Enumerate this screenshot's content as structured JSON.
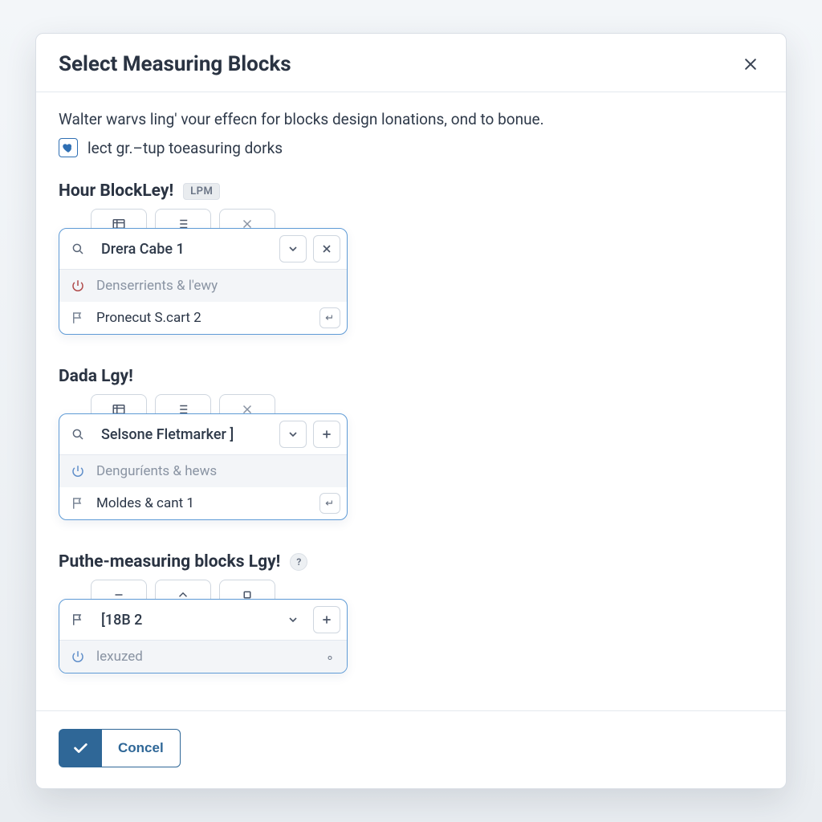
{
  "modal": {
    "title": "Select Measuring Blocks",
    "intro": "Walter warvs ling' vour effecn for blocks design lonations, ond to bonue.",
    "checkbox_label": "lect gr.–tup toeasuring dorks",
    "checkbox_checked": true
  },
  "sections": [
    {
      "title": "Hour BlockLey!",
      "badge": "LPM",
      "picker": {
        "selected": "Drera Cabe 1",
        "action": "remove",
        "rows": [
          {
            "icon": "power",
            "tone": "red",
            "label": "Denserrients & l'ewy",
            "muted": true
          },
          {
            "icon": "flag",
            "tone": "",
            "label": "Pronecut S.cart 2",
            "muted": false,
            "trail": "return"
          }
        ]
      }
    },
    {
      "title": "Dada Lgy!",
      "picker": {
        "selected": "Selsone Fletmarker ]",
        "action": "add",
        "rows": [
          {
            "icon": "power",
            "tone": "blue",
            "label": "Denguríents & hews",
            "muted": true
          },
          {
            "icon": "flag",
            "tone": "",
            "label": "Moldes & cant 1",
            "muted": false,
            "trail": "return"
          }
        ]
      }
    },
    {
      "title": "Puthe-measuring blocks Lgy!",
      "info": "?",
      "picker": {
        "selected": "[18B 2",
        "action": "add",
        "lead_icon": "flag",
        "rows": [
          {
            "icon": "power",
            "tone": "blue",
            "label": "lexuzed",
            "muted": true
          }
        ]
      }
    }
  ],
  "footer": {
    "ok_label": "",
    "cancel_label": "Concel"
  }
}
